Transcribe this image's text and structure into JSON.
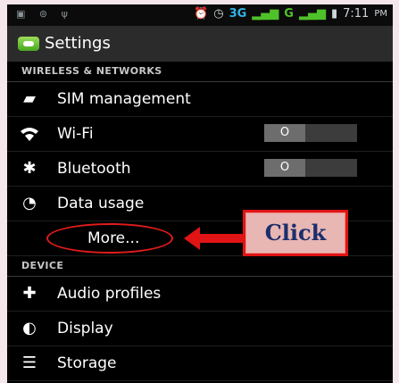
{
  "status_bar": {
    "left_icons": [
      "image-icon",
      "voicemail-icon",
      "usb-icon"
    ],
    "right_icons": [
      "alarm-icon",
      "clock-icon"
    ],
    "network_a": "3G",
    "network_b": "G",
    "time": "7:11",
    "ampm": "PM"
  },
  "action_bar": {
    "title": "Settings"
  },
  "sections": [
    {
      "header": "WIRELESS & NETWORKS",
      "items": [
        {
          "label": "SIM management",
          "icon": "sim-icon"
        },
        {
          "label": "Wi-Fi",
          "icon": "wifi-icon",
          "toggle": "O"
        },
        {
          "label": "Bluetooth",
          "icon": "bluetooth-icon",
          "toggle": "O"
        },
        {
          "label": "Data usage",
          "icon": "data-usage-icon"
        },
        {
          "label": "More...",
          "icon": ""
        }
      ]
    },
    {
      "header": "DEVICE",
      "items": [
        {
          "label": "Audio profiles",
          "icon": "audio-profiles-icon"
        },
        {
          "label": "Display",
          "icon": "display-icon"
        },
        {
          "label": "Storage",
          "icon": "storage-icon"
        }
      ]
    }
  ],
  "annotation": {
    "text": "Click",
    "color": "#e01414"
  }
}
